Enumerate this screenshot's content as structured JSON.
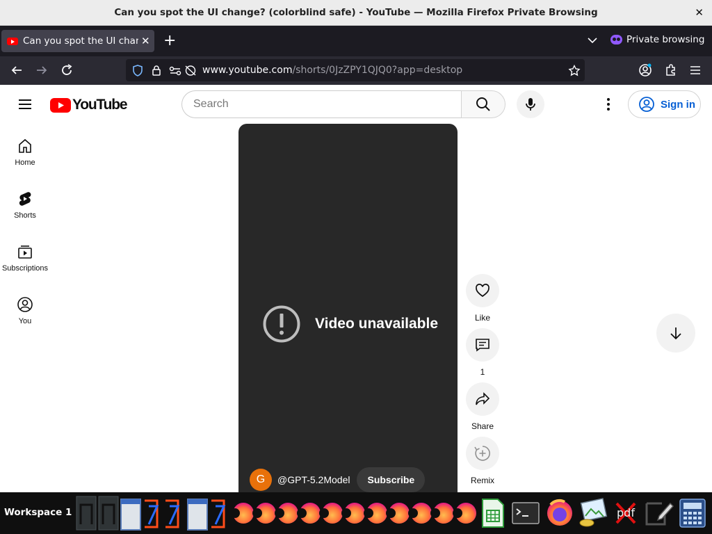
{
  "window": {
    "title": "Can you spot the UI change? (colorblind safe) - YouTube — Mozilla Firefox Private Browsing"
  },
  "tabs": [
    {
      "title": "Can you spot the UI change? (colorblind safe) - YouTube"
    }
  ],
  "private_label": "Private browsing",
  "url": {
    "domain": "www.youtube.com",
    "path": "/shorts/0JzZPY1QJQ0?app=desktop"
  },
  "yt": {
    "logo_text": "YouTube",
    "search_placeholder": "Search",
    "signin_label": "Sign in",
    "sidebar": [
      {
        "label": "Home",
        "icon": "home-icon"
      },
      {
        "label": "Shorts",
        "icon": "shorts-icon"
      },
      {
        "label": "Subscriptions",
        "icon": "subscriptions-icon"
      },
      {
        "label": "You",
        "icon": "you-icon"
      }
    ]
  },
  "player": {
    "message": "Video unavailable",
    "channel_initial": "G",
    "channel_handle": "@GPT-5.2Model",
    "subscribe_label": "Subscribe"
  },
  "actions": [
    {
      "label": "Like",
      "icon": "heart-icon"
    },
    {
      "label": "1",
      "icon": "comment-icon"
    },
    {
      "label": "Share",
      "icon": "share-icon"
    },
    {
      "label": "Remix",
      "icon": "remix-icon"
    }
  ],
  "taskbar": {
    "workspace_label": "Workspace 1",
    "pdf_label": "pdf"
  },
  "colors": {
    "yt_red": "#ff0000",
    "link_blue": "#065fd4",
    "firefox_dark": "#1c1b22",
    "private_purple": "#9059ff"
  }
}
